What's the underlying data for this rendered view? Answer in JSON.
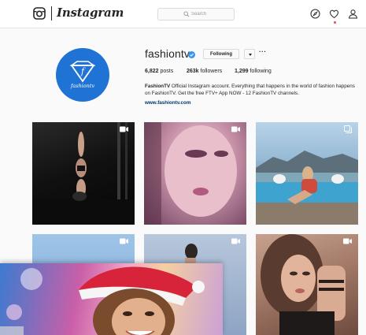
{
  "header": {
    "wordmark": "Instagram",
    "search_placeholder": "Search",
    "icons": [
      "instagram-glyph-icon",
      "search-icon",
      "compass-icon",
      "heart-icon",
      "person-icon"
    ],
    "notification_dot_color": "#ed4956"
  },
  "profile": {
    "avatar_text": "fashiontv",
    "avatar_color": "#1f73d4",
    "username": "fashiontv",
    "verified_color": "#3897f0",
    "follow_button": "Following",
    "more": "···",
    "stats": {
      "posts_count": "6,822",
      "posts_label": "posts",
      "followers_count": "263k",
      "followers_label": "followers",
      "following_count": "1,299",
      "following_label": "following"
    },
    "bio_name": "FashionTV",
    "bio_text": " Official Instagram account. Everything that happens in the world of fashion happens on FashionTV. Get the free FTV+ App NOW - 12 FashionTV channels.",
    "bio_link": "www.fashiontv.com",
    "link_color": "#003569"
  },
  "posts": [
    {
      "badge": "video-icon"
    },
    {
      "badge": "video-icon"
    },
    {
      "badge": "multiple-photos-icon"
    },
    {
      "badge": "video-icon"
    },
    {
      "badge": "video-icon"
    },
    {
      "badge": "video-icon"
    }
  ]
}
